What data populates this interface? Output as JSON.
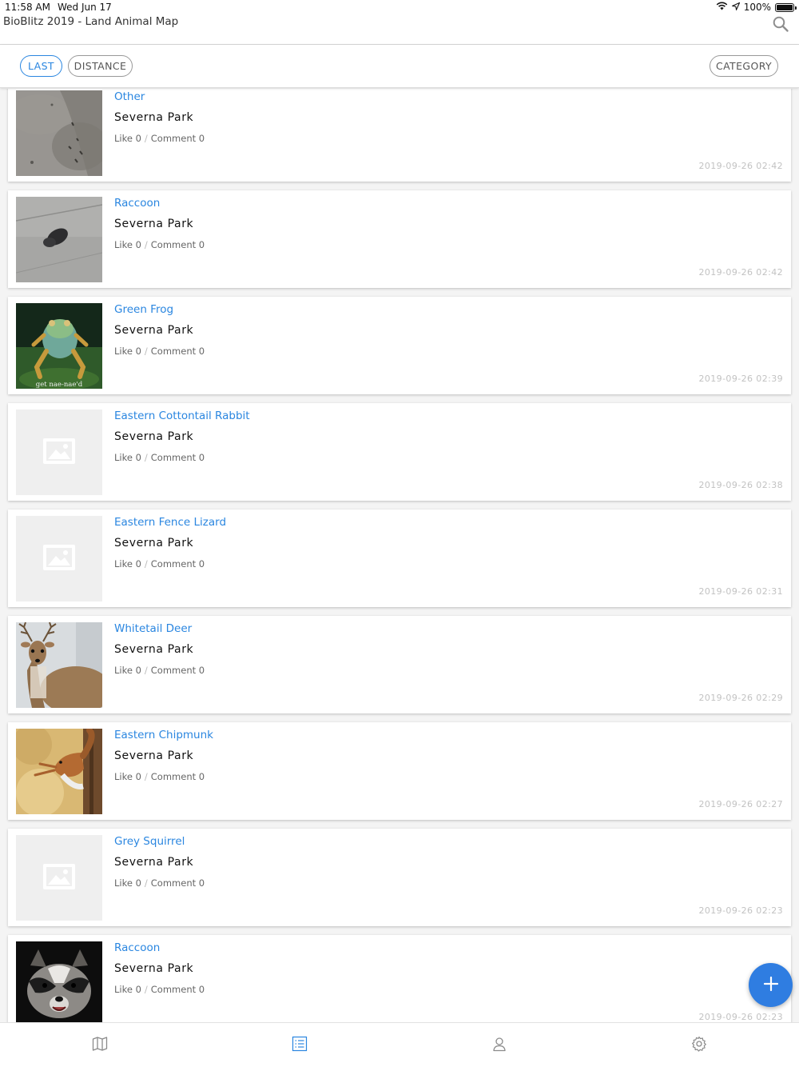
{
  "status_bar": {
    "time": "11:58 AM",
    "date": "Wed Jun 17",
    "battery": "100%",
    "battery_level": 1.0
  },
  "header": {
    "title": "BioBlitz 2019 - Land Animal Map",
    "search_icon": "search-icon"
  },
  "filters": {
    "last": "LAST",
    "distance": "DISTANCE",
    "category": "CATEGORY",
    "active_color": "#2a86e0"
  },
  "items": [
    {
      "title": "Other",
      "location": "Severna Park",
      "like": "Like 0",
      "sep": "/",
      "comment": "Comment 0",
      "date": "2019-09-26 02:42",
      "thumb": "photo-ground"
    },
    {
      "title": "Raccoon",
      "location": "Severna Park",
      "like": "Like 0",
      "sep": "/",
      "comment": "Comment 0",
      "date": "2019-09-26 02:42",
      "thumb": "photo-concrete"
    },
    {
      "title": "Green Frog",
      "location": "Severna Park",
      "like": "Like 0",
      "sep": "/",
      "comment": "Comment 0",
      "date": "2019-09-26 02:39",
      "thumb": "photo-frog",
      "thumb_caption": "get nae-nae'd"
    },
    {
      "title": "Eastern Cottontail Rabbit",
      "location": "Severna Park",
      "like": "Like 0",
      "sep": "/",
      "comment": "Comment 0",
      "date": "2019-09-26 02:38",
      "thumb": "placeholder-image-icon"
    },
    {
      "title": "Eastern Fence Lizard",
      "location": "Severna Park",
      "like": "Like 0",
      "sep": "/",
      "comment": "Comment 0",
      "date": "2019-09-26 02:31",
      "thumb": "placeholder-image-icon"
    },
    {
      "title": "Whitetail Deer",
      "location": "Severna Park",
      "like": "Like 0",
      "sep": "/",
      "comment": "Comment 0",
      "date": "2019-09-26 02:29",
      "thumb": "photo-deer"
    },
    {
      "title": "Eastern Chipmunk",
      "location": "Severna Park",
      "like": "Like 0",
      "sep": "/",
      "comment": "Comment 0",
      "date": "2019-09-26 02:27",
      "thumb": "photo-chipmunk"
    },
    {
      "title": "Grey Squirrel",
      "location": "Severna Park",
      "like": "Like 0",
      "sep": "/",
      "comment": "Comment 0",
      "date": "2019-09-26 02:23",
      "thumb": "placeholder-image-icon"
    },
    {
      "title": "Raccoon",
      "location": "Severna Park",
      "like": "Like 0",
      "sep": "/",
      "comment": "Comment 0",
      "date": "2019-09-26 02:23",
      "thumb": "photo-raccoon"
    }
  ],
  "fab": {
    "icon": "plus-icon",
    "color": "#2f7de1"
  },
  "tab_bar": {
    "tabs": [
      {
        "icon": "map-icon",
        "active": false
      },
      {
        "icon": "list-icon",
        "active": true
      },
      {
        "icon": "user-icon",
        "active": false
      },
      {
        "icon": "gear-icon",
        "active": false
      }
    ],
    "active_color": "#2a86e0",
    "inactive_color": "#8a8a8a"
  }
}
